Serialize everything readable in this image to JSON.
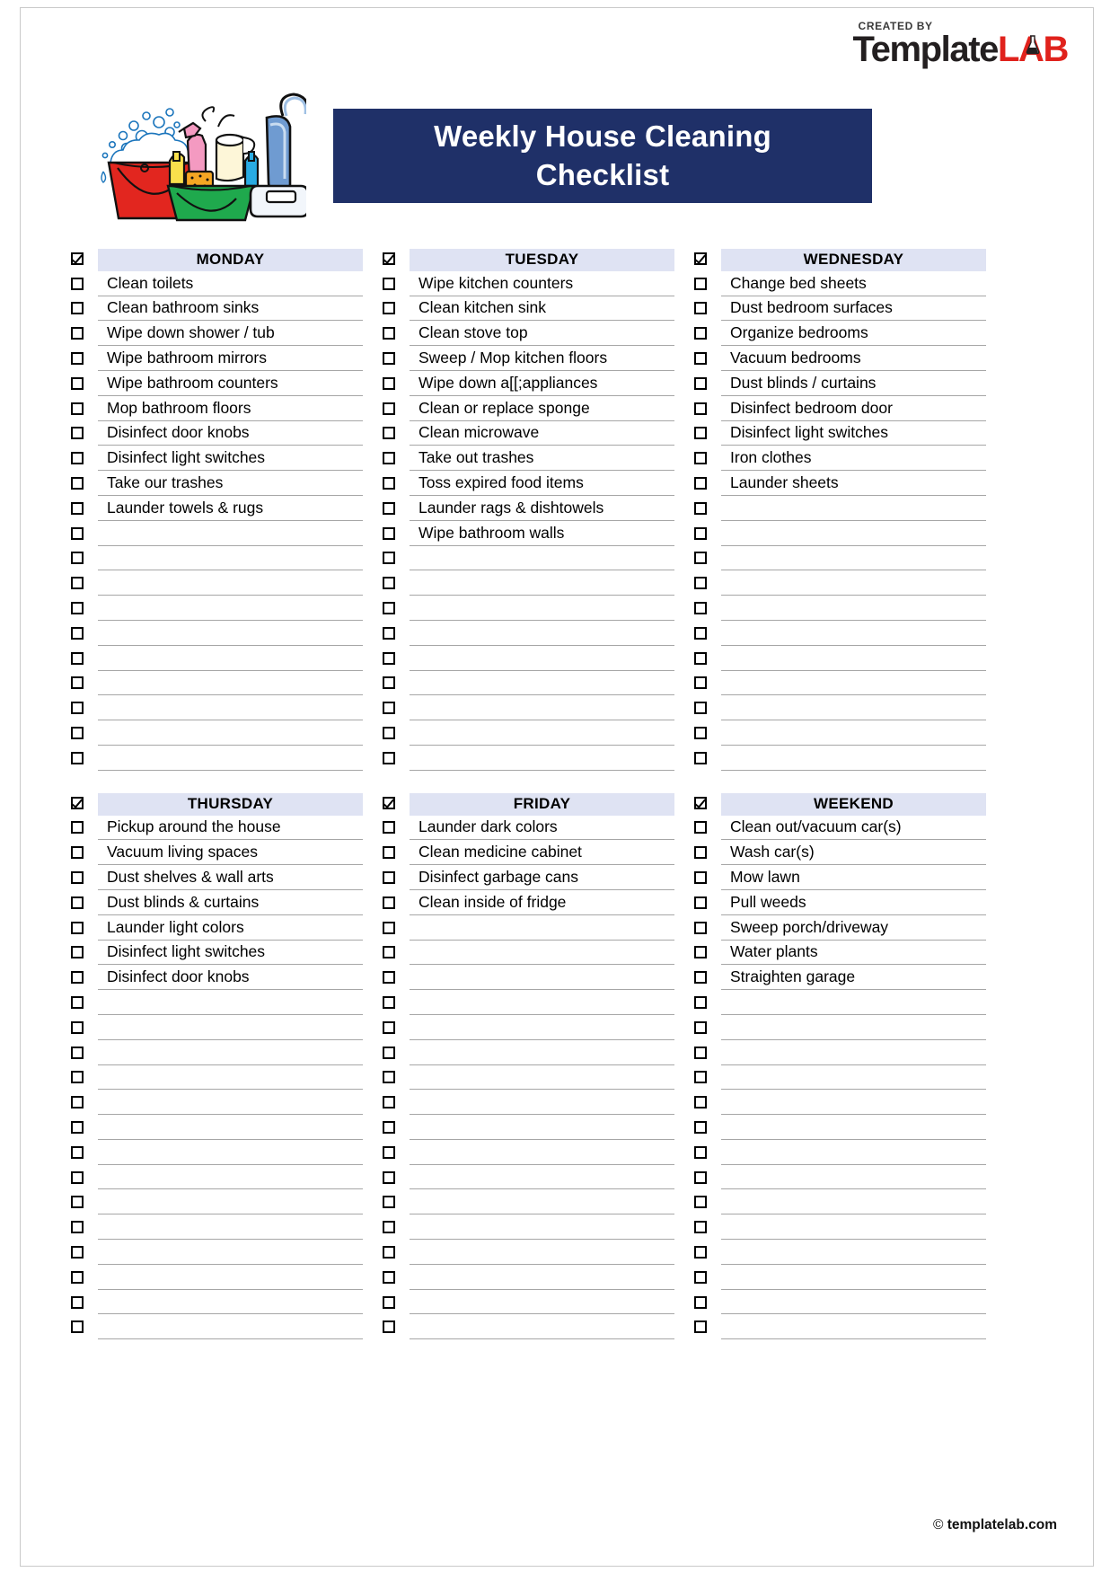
{
  "brand": {
    "created_by": "CREATED BY",
    "name_dark": "Template",
    "name_accent": "LAB",
    "accent_color": "#e0221c",
    "dark_color": "#231f20",
    "flask_icon": "flask-icon"
  },
  "title": {
    "line1": "Weekly House Cleaning",
    "line2": "Checklist",
    "banner_color": "#1f3068",
    "text_color": "#ffffff"
  },
  "illustration": {
    "name": "cleaning-supplies-illustration",
    "elements": [
      "red-bucket-with-bubbles",
      "green-bucket-with-supplies",
      "pink-spray-bottle",
      "paper-towel-roll",
      "sponge",
      "blue-vacuum-cleaner"
    ]
  },
  "header_row_color": "#dfe3f3",
  "rule_color": "#a6a6a6",
  "columns": [
    {
      "id": "monday",
      "header": "MONDAY",
      "header_checked": true,
      "total_rows": 20,
      "items": [
        "Clean toilets",
        "Clean bathroom sinks",
        "Wipe down shower / tub",
        "Wipe bathroom mirrors",
        "Wipe bathroom counters",
        "Mop bathroom floors",
        "Disinfect door knobs",
        "Disinfect light switches",
        "Take our trashes",
        "Launder towels & rugs"
      ]
    },
    {
      "id": "tuesday",
      "header": "TUESDAY",
      "header_checked": true,
      "total_rows": 20,
      "items": [
        "Wipe kitchen counters",
        "Clean kitchen sink",
        "Clean stove top",
        "Sweep / Mop kitchen floors",
        "Wipe down a[[;appliances",
        "Clean or replace sponge",
        "Clean microwave",
        "Take out trashes",
        "Toss expired food items",
        "Launder rags & dishtowels",
        "Wipe bathroom walls"
      ]
    },
    {
      "id": "wednesday",
      "header": "WEDNESDAY",
      "header_checked": true,
      "total_rows": 20,
      "items": [
        "Change bed sheets",
        "Dust bedroom surfaces",
        "Organize bedrooms",
        "Vacuum bedrooms",
        "Dust blinds / curtains",
        "Disinfect bedroom door",
        "Disinfect light switches",
        "Iron clothes",
        "Launder sheets"
      ]
    },
    {
      "id": "thursday",
      "header": "THURSDAY",
      "header_checked": true,
      "total_rows": 21,
      "items": [
        "Pickup around the house",
        "Vacuum living spaces",
        "Dust shelves & wall arts",
        "Dust blinds & curtains",
        "Launder light colors",
        "Disinfect light switches",
        "Disinfect door knobs"
      ]
    },
    {
      "id": "friday",
      "header": "FRIDAY",
      "header_checked": true,
      "total_rows": 21,
      "items": [
        "Launder dark colors",
        "Clean medicine cabinet",
        "Disinfect garbage cans",
        "Clean inside of fridge"
      ]
    },
    {
      "id": "weekend",
      "header": "WEEKEND",
      "header_checked": true,
      "total_rows": 21,
      "items": [
        "Clean out/vacuum car(s)",
        "Wash car(s)",
        "Mow lawn",
        "Pull weeds",
        "Sweep porch/driveway",
        "Water plants",
        "Straighten garage"
      ]
    }
  ],
  "footer": {
    "copyright_symbol": "©",
    "site": "templatelab.com"
  }
}
